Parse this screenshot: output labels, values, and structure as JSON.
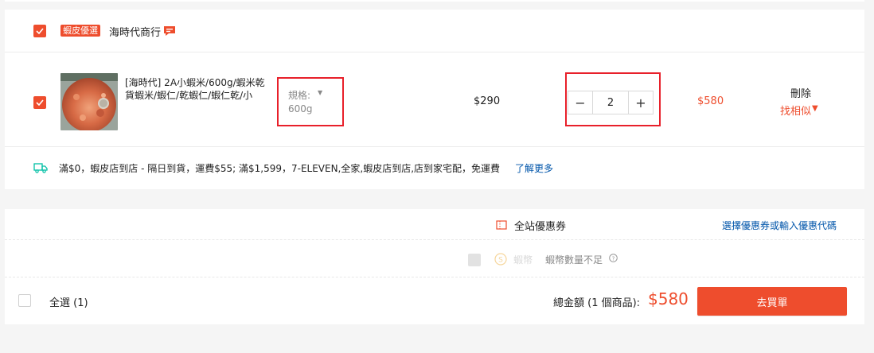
{
  "colors": {
    "accent": "#ee4d2d",
    "link": "#05a",
    "shipping_icon": "#00bfa5",
    "highlight_border": "#e8202a"
  },
  "shop": {
    "badge": "蝦皮優選",
    "name": "海時代商行",
    "chat_icon": "chat-icon"
  },
  "item": {
    "title": "[海時代] 2A小蝦米/600g/蝦米乾貨蝦米/蝦仁/乾蝦仁/蝦仁乾/小蝦…",
    "variation_label": "規格:",
    "variation_value": "600g",
    "unit_price": "$290",
    "quantity": "2",
    "qty_minus": "−",
    "qty_plus": "+",
    "total": "$580",
    "delete": "刪除",
    "find_similar": "找相似"
  },
  "shipping": {
    "text": "滿$0，蝦皮店到店 - 隔日到貨，運費$55; 滿$1,599，7-ELEVEN,全家,蝦皮店到店,店到家宅配，免運費",
    "link": "了解更多"
  },
  "voucher": {
    "label": "全站優惠券",
    "link": "選擇優惠券或輸入優惠代碼"
  },
  "coins": {
    "label": "蝦幣",
    "status": "蝦幣數量不足"
  },
  "footer": {
    "select_all": "全選 (1)",
    "total_label": "總金額 (1 個商品):",
    "total_value": "$580",
    "checkout": "去買單"
  }
}
